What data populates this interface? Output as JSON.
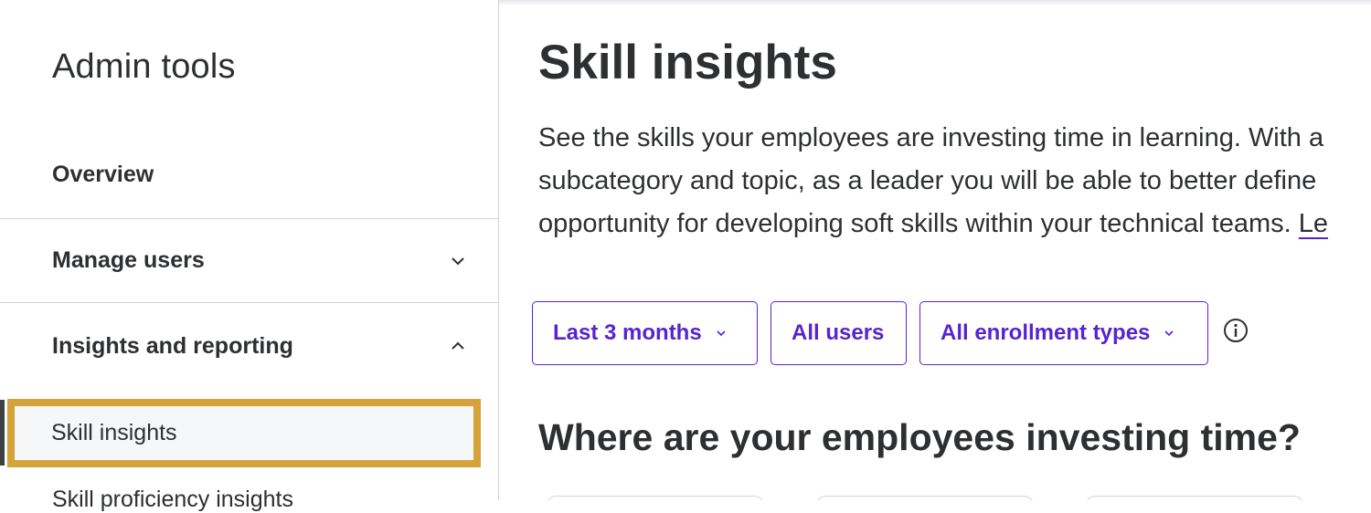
{
  "sidebar": {
    "title": "Admin tools",
    "items": [
      {
        "label": "Overview"
      },
      {
        "label": "Manage users"
      },
      {
        "label": "Insights and reporting"
      }
    ],
    "sub_items": [
      {
        "label": "Skill insights"
      },
      {
        "label": "Skill proficiency insights"
      }
    ]
  },
  "main": {
    "title": "Skill insights",
    "description_lines": [
      "See the skills your employees are investing time in learning. With a",
      "subcategory and topic, as a leader you will be able to better define",
      "opportunity for developing soft skills within your technical teams. "
    ],
    "description_link": "Le",
    "filters": [
      {
        "label": "Last 3 months"
      },
      {
        "label": "All users"
      },
      {
        "label": "All enrollment types"
      }
    ],
    "section_title": "Where are your employees investing time?"
  },
  "colors": {
    "accent": "#5624d0",
    "highlight": "#d6a23a",
    "text": "#2d2f31",
    "divider": "#d1d2e0"
  },
  "icons": {
    "nav_manage": "chevron-down-icon",
    "nav_insights": "chevron-up-icon",
    "info": "info-icon"
  }
}
